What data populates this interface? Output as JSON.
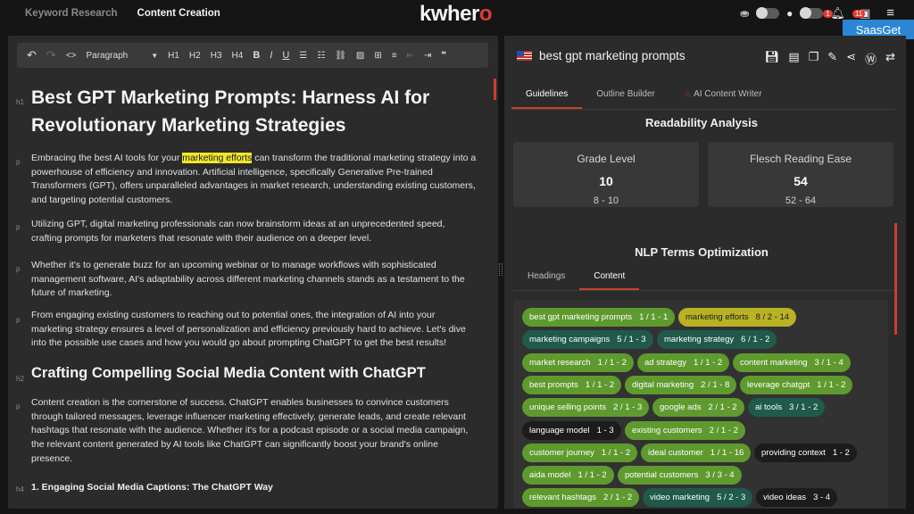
{
  "topbar": {
    "nav": [
      "Keyword Research",
      "Content Creation"
    ],
    "logo_a": "kwher",
    "logo_b": "o",
    "badge1": "1",
    "badge2": "11",
    "saas": "SaasGet"
  },
  "toolbar": {
    "paragraph": "Paragraph",
    "h1": "H1",
    "h2": "H2",
    "h3": "H3",
    "h4": "H4",
    "bold": "B",
    "italic": "I",
    "underline": "U"
  },
  "doc": {
    "h1": "Best GPT Marketing Prompts: Harness AI for Revolutionary Marketing Strategies",
    "p1a": "Embracing the best AI tools for your ",
    "p1hl": "marketing efforts",
    "p1b": " can transform the traditional marketing strategy into a powerhouse of efficiency and innovation. Artificial intelligence, specifically Generative Pre-trained Transformers (GPT), offers unparalleled advantages in market research, understanding existing customers, and targeting potential customers.",
    "p2": "Utilizing GPT, digital marketing professionals can now brainstorm ideas at an unprecedented speed, crafting prompts for marketers that resonate with their audience on a deeper level.",
    "p3": "Whether it's to generate buzz for an upcoming webinar or to manage workflows with sophisticated management software, AI's adaptability across different marketing channels stands as a testament to the future of marketing.",
    "p4": "From engaging existing customers to reaching out to potential ones, the integration of AI into your marketing strategy ensures a level of personalization and efficiency previously hard to achieve. Let's dive into the possible use cases and how you would go about prompting ChatGPT to get the best results!",
    "h2": "Crafting Compelling Social Media Content with ChatGPT",
    "p5": "Content creation is the cornerstone of success. ChatGPT enables businesses to convince customers through tailored messages, leverage influencer marketing effectively, generate leads, and create relevant hashtags that resonate with the audience. Whether it's for a podcast episode or a social media campaign, the relevant content generated by AI tools like ChatGPT can significantly boost your brand's online presence.",
    "h4": "1. Engaging Social Media Captions: The ChatGPT Way",
    "tags": {
      "h1": "h1",
      "p": "p",
      "h2": "h2",
      "h4": "h4"
    }
  },
  "panel": {
    "title": "best gpt marketing prompts",
    "tabs": [
      "Guidelines",
      "Outline Builder",
      "AI Content Writer"
    ],
    "readability": "Readability Analysis",
    "grade": {
      "label": "Grade Level",
      "value": "10",
      "range": "8  - 10"
    },
    "flesch": {
      "label": "Flesch Reading Ease",
      "value": "54",
      "range": "52 - 64"
    },
    "nlp": "NLP Terms Optimization",
    "ctabs": [
      "Headings",
      "Content"
    ],
    "terms": [
      {
        "t": "best gpt marketing prompts",
        "c": "1 / 1 - 1",
        "k": "g"
      },
      {
        "t": "marketing efforts",
        "c": "8 / 2 - 14",
        "k": "y"
      },
      {
        "t": "marketing campaigns",
        "c": "5 / 1 - 3",
        "k": "tl"
      },
      {
        "t": "marketing strategy",
        "c": "6 / 1 - 2",
        "k": "tl"
      },
      {
        "t": "market research",
        "c": "1 / 1 - 2",
        "k": "g"
      },
      {
        "t": "ad strategy",
        "c": "1 / 1 - 2",
        "k": "g"
      },
      {
        "t": "content marketing",
        "c": "3 / 1 - 4",
        "k": "g"
      },
      {
        "t": "best prompts",
        "c": "1 / 1 - 2",
        "k": "g"
      },
      {
        "t": "digital marketing",
        "c": "2 / 1 - 8",
        "k": "g"
      },
      {
        "t": "leverage chatgpt",
        "c": "1 / 1 - 2",
        "k": "g"
      },
      {
        "t": "unique selling points",
        "c": "2 / 1 - 3",
        "k": "g"
      },
      {
        "t": "google ads",
        "c": "2 / 1 - 2",
        "k": "g"
      },
      {
        "t": "ai tools",
        "c": "3 / 1 - 2",
        "k": "tl"
      },
      {
        "t": "language model",
        "c": "1 - 3",
        "k": "dk"
      },
      {
        "t": "existing customers",
        "c": "2 / 1 - 2",
        "k": "g"
      },
      {
        "t": "customer journey",
        "c": "1 / 1 - 2",
        "k": "g"
      },
      {
        "t": "ideal customer",
        "c": "1 / 1 - 16",
        "k": "g"
      },
      {
        "t": "providing context",
        "c": "1 - 2",
        "k": "dk"
      },
      {
        "t": "aida model",
        "c": "1 / 1 - 2",
        "k": "g"
      },
      {
        "t": "potential customers",
        "c": "3 / 3 - 4",
        "k": "g"
      },
      {
        "t": "relevant hashtags",
        "c": "2 / 1 - 2",
        "k": "g"
      },
      {
        "t": "video marketing",
        "c": "5 / 2 - 3",
        "k": "tl"
      },
      {
        "t": "video ideas",
        "c": "3 - 4",
        "k": "dk"
      }
    ]
  }
}
